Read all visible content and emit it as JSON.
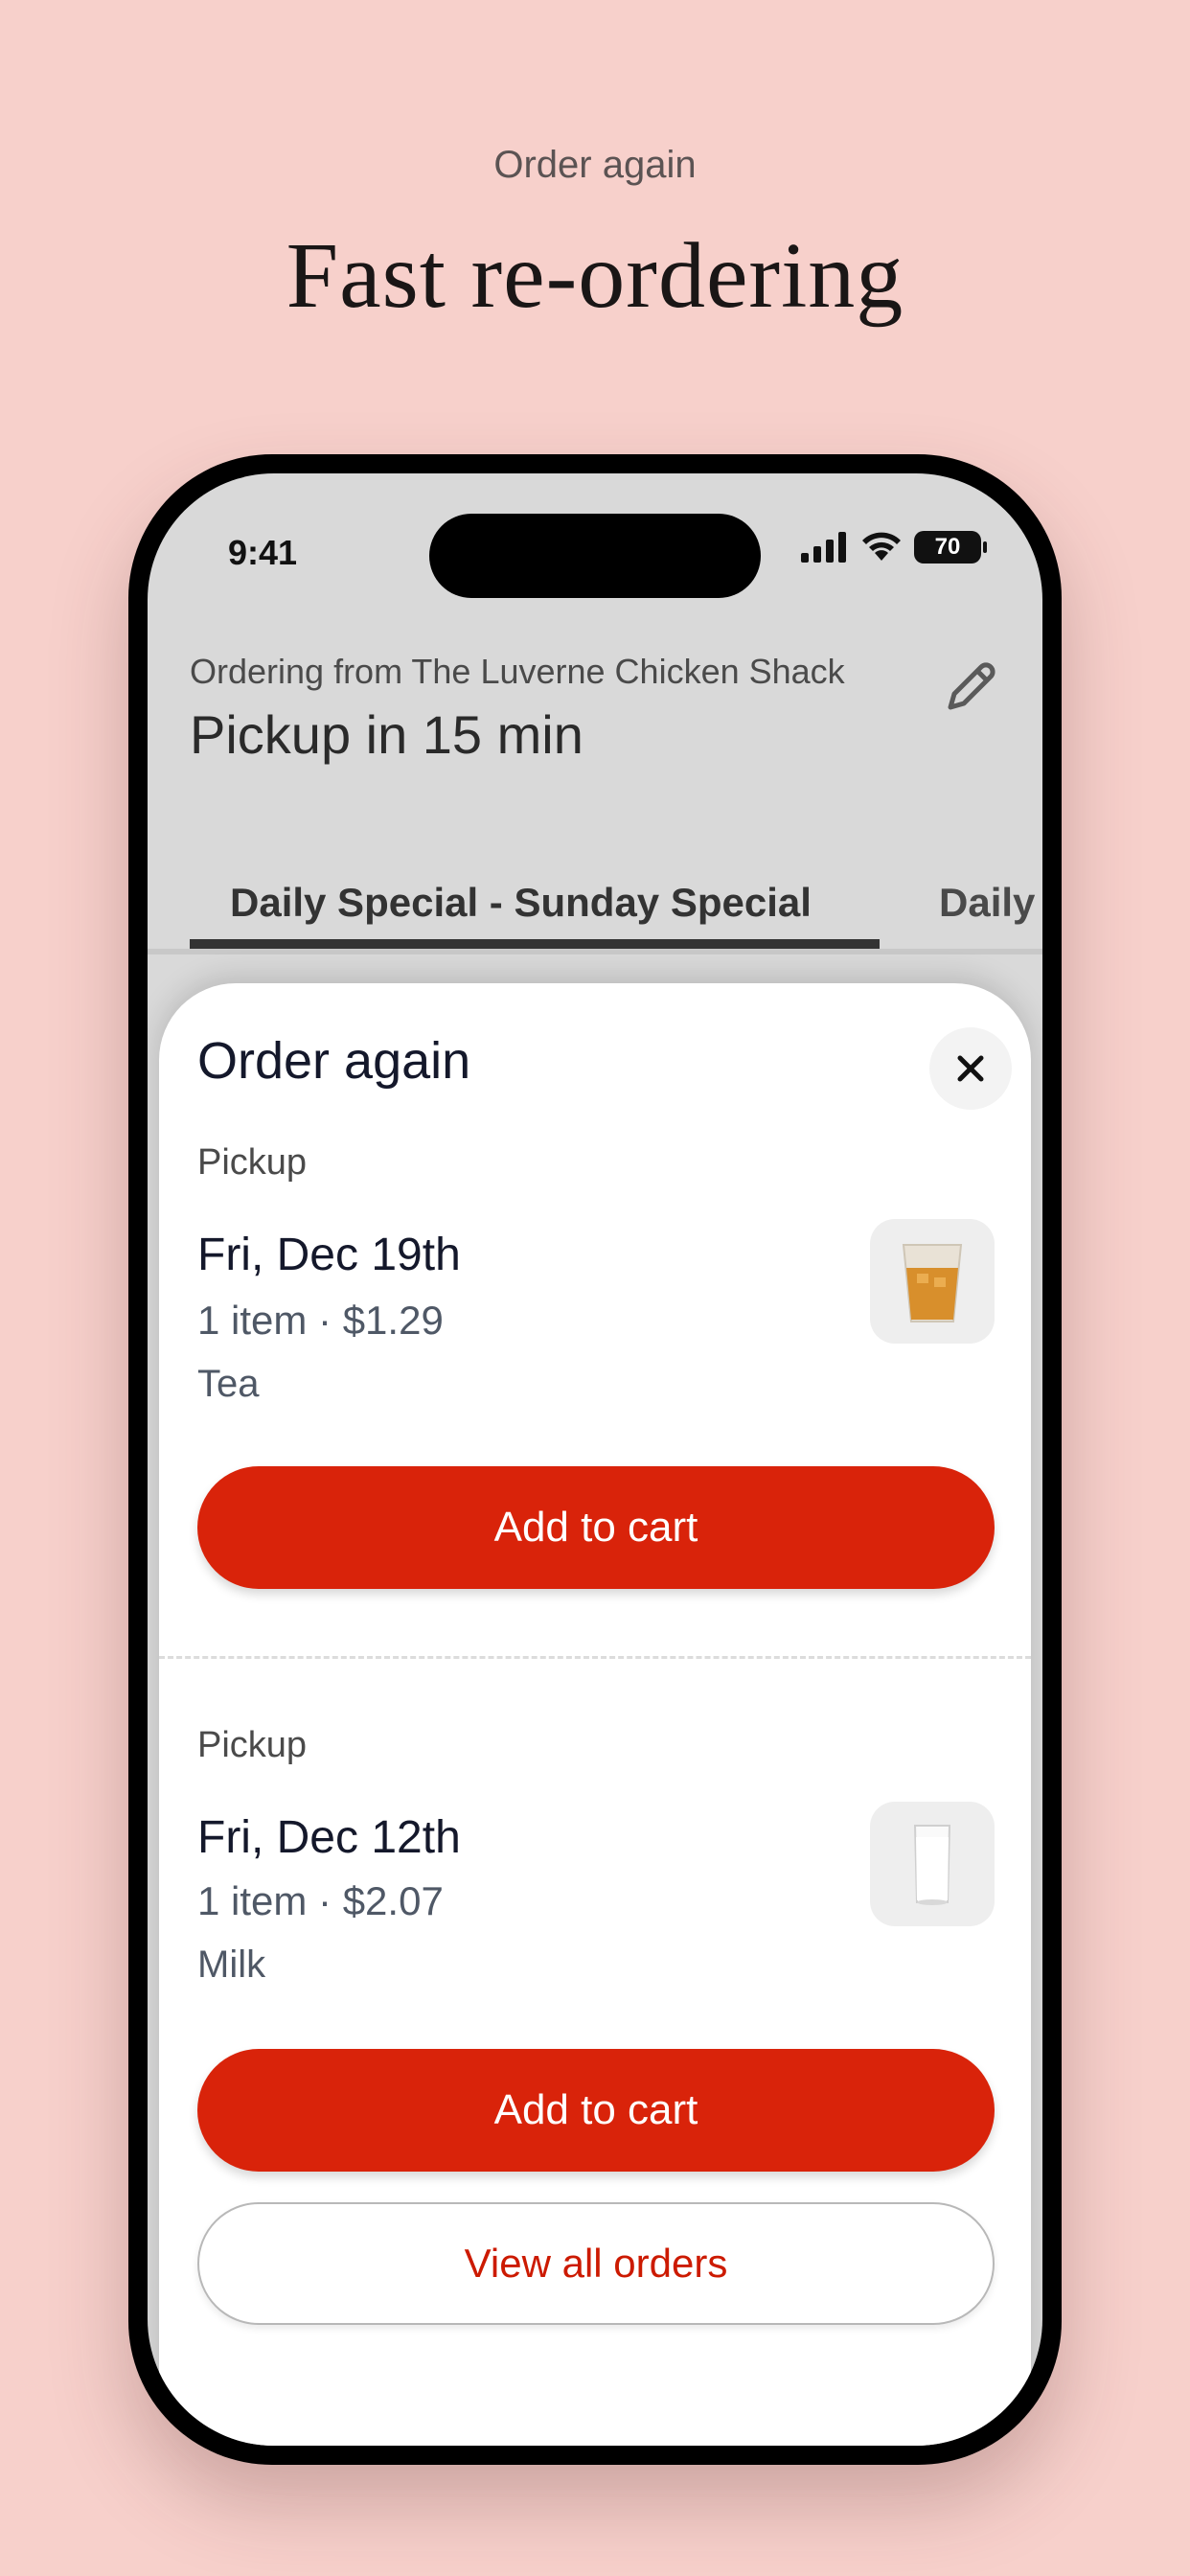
{
  "promo": {
    "kicker": "Order again",
    "title": "Fast re-ordering"
  },
  "status_bar": {
    "time": "9:41",
    "battery": "70"
  },
  "header": {
    "ordering_from": "Ordering from The Luverne Chicken Shack",
    "pickup_time": "Pickup in 15 min",
    "edit_icon": "pencil-icon"
  },
  "tabs": [
    {
      "label": "Daily Special - Sunday Special",
      "active": true
    },
    {
      "label": "Daily S",
      "active": false
    }
  ],
  "sheet": {
    "title": "Order again",
    "close_icon": "close-icon",
    "orders": [
      {
        "kind": "Pickup",
        "date": "Fri, Dec 19th",
        "meta": "1 item · $1.29",
        "item": "Tea",
        "thumb_icon": "iced-tea-cup-icon",
        "add_label": "Add to cart"
      },
      {
        "kind": "Pickup",
        "date": "Fri, Dec 12th",
        "meta": "1 item · $2.07",
        "item": "Milk",
        "thumb_icon": "milk-glass-icon",
        "add_label": "Add to cart"
      }
    ],
    "view_all_label": "View all orders"
  },
  "colors": {
    "background": "#f7d0cb",
    "accent": "#d9230a",
    "link": "#cc1a00"
  }
}
